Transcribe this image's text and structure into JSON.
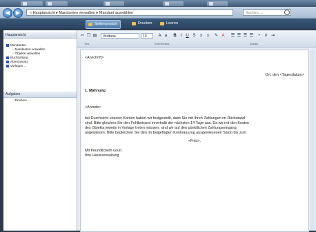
{
  "window": {
    "address": "« Hauptansicht ▸ Mandanten verwalten ▸ Mandant auswählen",
    "search_placeholder": "Suchen ..."
  },
  "view_tabs": [
    "Seitenansicht",
    "Drucken",
    "Leeren"
  ],
  "left_panel": {
    "header": "Hauptansicht",
    "tree": [
      {
        "label": "Mandanten",
        "level": 0
      },
      {
        "label": "Mandanten verwalten",
        "level": 1
      },
      {
        "label": "Objekte verwalten",
        "level": 1
      },
      {
        "label": "Buchhaltung",
        "level": 0
      },
      {
        "label": "Abrechnung",
        "level": 0
      },
      {
        "label": "Vorlagen ...",
        "level": 0
      }
    ],
    "tasks_header": "Aufgaben",
    "tasks": [
      "Drucken ..."
    ]
  },
  "toolbar": {
    "font": "Verdana",
    "size": "10",
    "groups": [
      "Text",
      "Zeichensatz",
      "Absatz"
    ]
  },
  "document": {
    "anschrift": "<Anschrift>",
    "date_line": "Ort, den <Tagesdatum>",
    "title": "1. Mahnung",
    "anrede": "<Anrede>",
    "body": [
      "bei Durchsicht unserer Konten haben wir festgestellt, dass Sie mit Ihren Zahlungen im Rückstand",
      "sind. Bitte gleichen Sie den Fehlbetrand innerhalb der nächsten 14 Tage aus. Da wir mit den Kosten",
      "des Objekts jeweils in Vorlage treten müssen, sind wir auf den pünktlichen Zahlungseingang",
      "angewiesen. Bitte begleichen Sie den im beigefügten Kontoauszug ausgewiesenen Saldo bis zum"
    ],
    "frist": "<Frist>.",
    "closing": "Mit freundlichem Gruß",
    "signature": "Ihre Hausverwaltung"
  }
}
